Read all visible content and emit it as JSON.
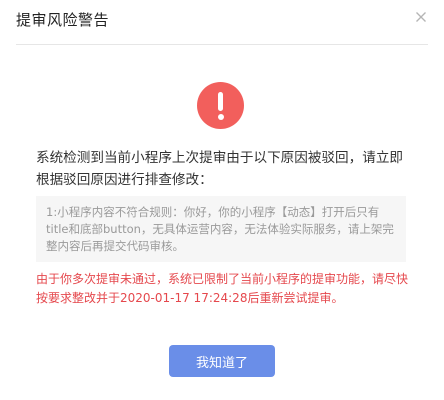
{
  "dialog": {
    "title": "提审风险警告",
    "message": "系统检测到当前小程序上次提审由于以下原因被驳回，请立即根据驳回原因进行排查修改：",
    "reason": "1:小程序内容不符合规则：你好，你的小程序【动态】打开后只有title和底部button，无具体运营内容，无法体验实际服务，请上架完整内容后再提交代码审核。",
    "limit_notice": "由于你多次提审未通过，系统已限制了当前小程序的提审功能，请尽快按要求整改并于2020-01-17 17:24:28后重新尝试提审。",
    "confirm_label": "我知道了"
  },
  "icons": {
    "close": "close-icon",
    "warning": "exclamation-icon"
  },
  "colors": {
    "warning": "#f25f5c",
    "notice_text": "#e5484d",
    "button": "#6a8ee8"
  }
}
